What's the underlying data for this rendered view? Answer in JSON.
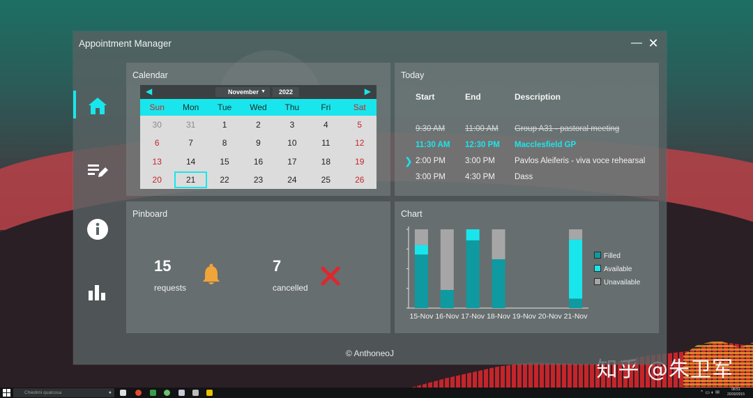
{
  "window": {
    "title": "Appointment Manager",
    "minimize": "—",
    "close": "✕"
  },
  "nav": [
    {
      "icon": "home-icon",
      "active": true
    },
    {
      "icon": "notes-icon",
      "active": false
    },
    {
      "icon": "info-icon",
      "active": false
    },
    {
      "icon": "bar-chart-icon",
      "active": false
    }
  ],
  "calendar": {
    "title": "Calendar",
    "month": "November",
    "year": "2022",
    "weekdays": [
      "Sun",
      "Mon",
      "Tue",
      "Wed",
      "Thu",
      "Fri",
      "Sat"
    ],
    "weeks": [
      [
        "30",
        "31",
        "1",
        "2",
        "3",
        "4",
        "5"
      ],
      [
        "6",
        "7",
        "8",
        "9",
        "10",
        "11",
        "12"
      ],
      [
        "13",
        "14",
        "15",
        "16",
        "17",
        "18",
        "19"
      ],
      [
        "20",
        "21",
        "22",
        "23",
        "24",
        "25",
        "26"
      ]
    ],
    "selected": "21"
  },
  "today": {
    "title": "Today",
    "headers": {
      "start": "Start",
      "end": "End",
      "description": "Description"
    },
    "rows": [
      {
        "start": "9:30 AM",
        "end": "11:00 AM",
        "description": "Group A31 - pastoral meeting",
        "state": "past"
      },
      {
        "start": "11:30 AM",
        "end": "12:30 PM",
        "description": "Macclesfield GP",
        "state": "current"
      },
      {
        "start": "2:00 PM",
        "end": "3:00 PM",
        "description": "Pavlos Aleiferis - viva voce rehearsal",
        "state": "next"
      },
      {
        "start": "3:00 PM",
        "end": "4:30 PM",
        "description": "Dass",
        "state": "later"
      }
    ]
  },
  "pinboard": {
    "title": "Pinboard",
    "requests_count": "15",
    "requests_label": "requests",
    "cancelled_count": "7",
    "cancelled_label": "cancelled"
  },
  "chart_panel": {
    "title": "Chart"
  },
  "chart_data": {
    "type": "bar",
    "stacked": true,
    "categories": [
      "15-Nov",
      "16-Nov",
      "17-Nov",
      "18-Nov",
      "19-Nov",
      "20-Nov",
      "21-Nov"
    ],
    "series": [
      {
        "name": "Filled",
        "color": "#0e9aa0",
        "values": [
          0.68,
          0.23,
          0.86,
          0.62,
          0,
          0,
          0.12
        ]
      },
      {
        "name": "Available",
        "color": "#19e6ec",
        "values": [
          0.12,
          0,
          0.14,
          0,
          0,
          0,
          0.75
        ]
      },
      {
        "name": "Unavailable",
        "color": "#a6a6a6",
        "values": [
          0.2,
          0.77,
          0,
          0.38,
          0,
          0,
          0.13
        ]
      }
    ],
    "ylim": [
      0,
      1
    ],
    "grid": false,
    "legend": "right"
  },
  "footer": {
    "text": "© AnthoneoJ"
  },
  "watermark": {
    "text": "知乎 @朱卫军"
  },
  "taskbar": {
    "search_placeholder": "Chiedimi qualcosa",
    "clock_time": "08:51",
    "clock_date": "20/30/2015"
  },
  "colors": {
    "accent": "#19e6ec",
    "weekend": "#c5262c",
    "bell": "#f0a43a",
    "cross": "#e0262c"
  }
}
